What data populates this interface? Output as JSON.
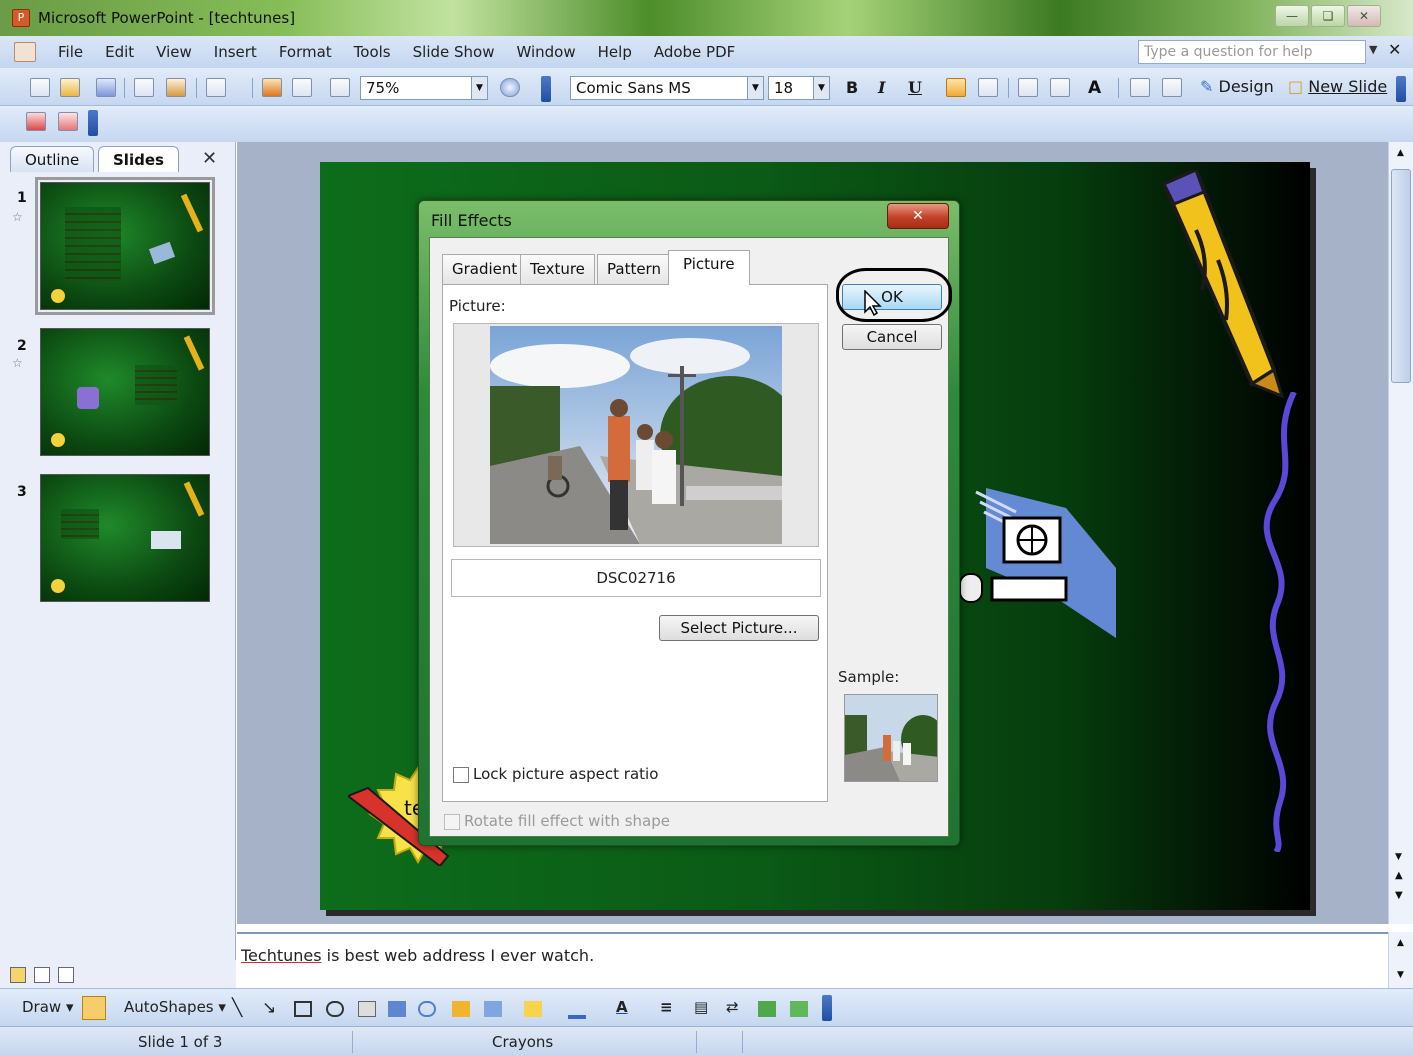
{
  "window": {
    "title": "Microsoft PowerPoint - [techtunes]"
  },
  "menu": {
    "items": [
      "File",
      "Edit",
      "View",
      "Insert",
      "Format",
      "Tools",
      "Slide Show",
      "Window",
      "Help",
      "Adobe PDF"
    ],
    "help_placeholder": "Type a question for help"
  },
  "toolbar": {
    "zoom": "75%",
    "font": "Comic Sans MS",
    "size": "18",
    "bold": "B",
    "italic": "I",
    "underline": "U",
    "design": "Design",
    "new_slide": "New Slide"
  },
  "slides_pane": {
    "tabs": [
      "Outline",
      "Slides"
    ],
    "slides": [
      {
        "number": "1"
      },
      {
        "number": "2"
      },
      {
        "number": "3"
      }
    ]
  },
  "slide_text": {
    "sticker": "tech"
  },
  "dialog": {
    "title": "Fill Effects",
    "tabs": [
      "Gradient",
      "Texture",
      "Pattern",
      "Picture"
    ],
    "picture_label": "Picture:",
    "picture_name": "DSC02716",
    "select_button": "Select Picture...",
    "lock_label": "Lock picture aspect ratio",
    "rotate_label": "Rotate fill effect with shape",
    "ok": "OK",
    "cancel": "Cancel",
    "sample_label": "Sample:"
  },
  "notes": {
    "linked": "Techtunes",
    "rest": " is best web address I ever watch."
  },
  "drawbar": {
    "draw": "Draw",
    "autoshapes": "AutoShapes"
  },
  "status": {
    "slide": "Slide 1 of 3",
    "design": "Crayons"
  },
  "colors": {
    "accent": "#1f4ea2",
    "slide_green": "#0b5a16",
    "dialog_frame": "#2d8a3b"
  }
}
